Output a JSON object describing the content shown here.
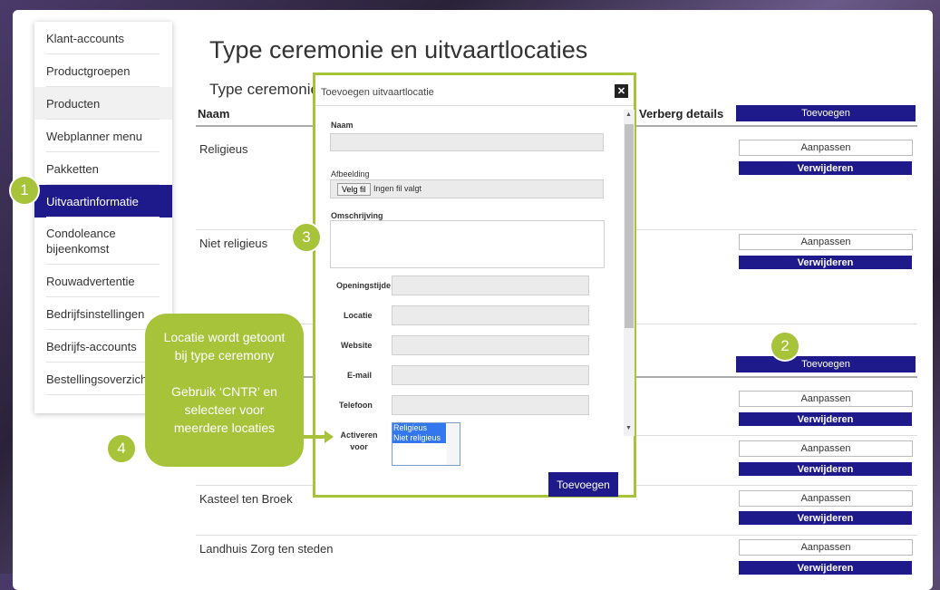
{
  "sidebar": {
    "items": [
      {
        "label": "Klant-accounts"
      },
      {
        "label": "Productgroepen"
      },
      {
        "label": "Producten"
      },
      {
        "label": "Webplanner menu"
      },
      {
        "label": "Pakketten"
      },
      {
        "label": "Uitvaartinformatie"
      },
      {
        "label": "Condoleance bijeenkomst"
      },
      {
        "label": "Rouwadvertentie"
      },
      {
        "label": "Bedrijfsinstellingen"
      },
      {
        "label": "Bedrijfs-accounts"
      },
      {
        "label": "Bestellingsoverzicht"
      }
    ]
  },
  "main": {
    "title": "Type ceremonie en uitvaartlocaties",
    "section_title": "Type ceremonie",
    "col_name": "Naam",
    "col_details": "Verberg details",
    "add_label": "Toevoegen",
    "edit_label": "Aanpassen",
    "delete_label": "Verwijderen",
    "rows_top": [
      "Religieus",
      "Niet religieus"
    ],
    "rows_bottom": [
      "Kasteel ten Broek",
      "Landhuis Zorg ten steden"
    ]
  },
  "modal": {
    "title": "Toevoegen uitvaartlocatie",
    "close_icon": "close-icon",
    "fields": {
      "naam": "Naam",
      "afbeelding": "Afbeelding",
      "file_button": "Velg fil",
      "file_status": "Ingen fil valgt",
      "omschrijving": "Omschrijving",
      "openingstijden": "Openingstijden",
      "locatie": "Locatie",
      "website": "Website",
      "email": "E-mail",
      "telefoon": "Telefoon",
      "activeren_voor": "Activeren voor"
    },
    "options": [
      "Religieus",
      "Niet religieus"
    ],
    "submit_label": "Toevoegen"
  },
  "annotations": {
    "c1": "1",
    "c2": "2",
    "c3": "3",
    "c4": "4",
    "callout_line1": "Locatie wordt getoont bij type ceremony",
    "callout_line2": "Gebruik ‘CNTR’ en selecteer voor meerdere locaties"
  },
  "colors": {
    "accent": "#1e1a8c",
    "annotation": "#a6c33a"
  }
}
